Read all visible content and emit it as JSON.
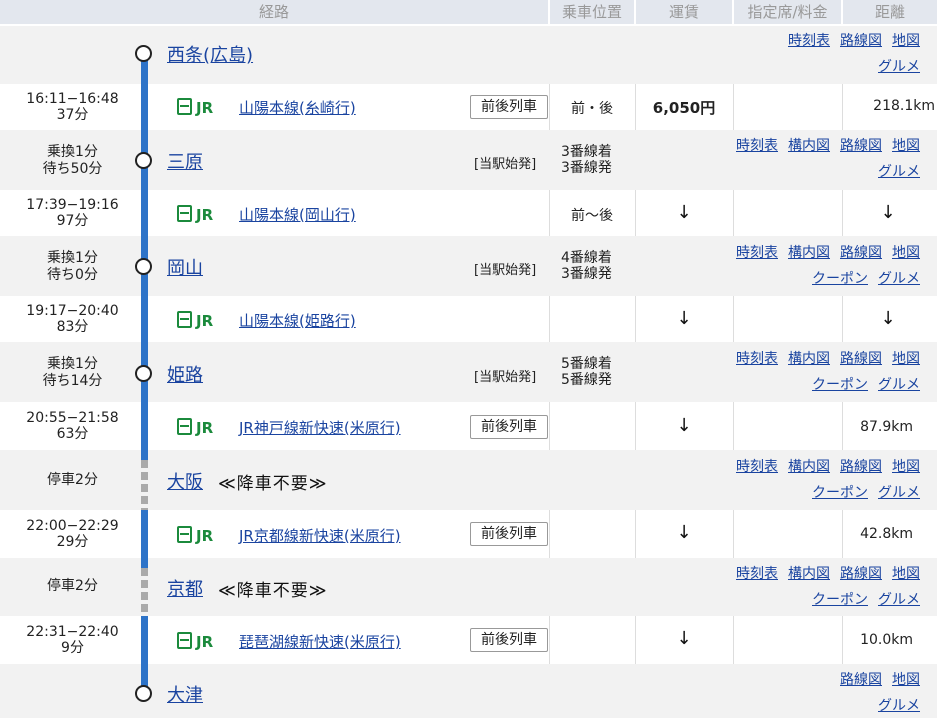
{
  "header": {
    "route": "経路",
    "position": "乗車位置",
    "fare": "運賃",
    "reserved": "指定席/料金",
    "distance": "距離"
  },
  "stations": {
    "saijo": {
      "name": "西条(広島)",
      "links": [
        "時刻表",
        "路線図",
        "地図",
        "グルメ"
      ]
    },
    "mihara": {
      "name": "三原",
      "transfer": "乗換1分",
      "wait": "待ち50分",
      "start": "[当駅始発]",
      "arrive": "3番線着",
      "depart": "3番線発",
      "links": [
        "時刻表",
        "構内図",
        "路線図",
        "地図",
        "グルメ"
      ]
    },
    "okayama": {
      "name": "岡山",
      "transfer": "乗換1分",
      "wait": "待ち0分",
      "start": "[当駅始発]",
      "arrive": "4番線着",
      "depart": "3番線発",
      "links": [
        "時刻表",
        "構内図",
        "路線図",
        "地図",
        "クーポン",
        "グルメ"
      ]
    },
    "himeji": {
      "name": "姫路",
      "transfer": "乗換1分",
      "wait": "待ち14分",
      "start": "[当駅始発]",
      "arrive": "5番線着",
      "depart": "5番線発",
      "links": [
        "時刻表",
        "構内図",
        "路線図",
        "地図",
        "クーポン",
        "グルメ"
      ]
    },
    "osaka": {
      "name": "大阪",
      "stop": "停車2分",
      "note": "≪降車不要≫",
      "links": [
        "時刻表",
        "構内図",
        "路線図",
        "地図",
        "クーポン",
        "グルメ"
      ]
    },
    "kyoto": {
      "name": "京都",
      "stop": "停車2分",
      "note": "≪降車不要≫",
      "links": [
        "時刻表",
        "構内図",
        "路線図",
        "地図",
        "クーポン",
        "グルメ"
      ]
    },
    "otsu": {
      "name": "大津",
      "links": [
        "路線図",
        "地図",
        "グルメ"
      ]
    }
  },
  "trains": {
    "t1": {
      "time": "16:11−16:48",
      "dur": "37分",
      "jr": "JR",
      "line": "山陽本線(糸崎行)",
      "btn": "前後列車",
      "pos": "前・後",
      "fare": "6,050円",
      "dist": "218.1km"
    },
    "t2": {
      "time": "17:39−19:16",
      "dur": "97分",
      "jr": "JR",
      "line": "山陽本線(岡山行)",
      "pos": "前〜後",
      "fare": "↓",
      "dist": "↓"
    },
    "t3": {
      "time": "19:17−20:40",
      "dur": "83分",
      "jr": "JR",
      "line": "山陽本線(姫路行)",
      "fare": "↓",
      "dist": "↓"
    },
    "t4": {
      "time": "20:55−21:58",
      "dur": "63分",
      "jr": "JR",
      "line": "JR神戸線新快速(米原行)",
      "btn": "前後列車",
      "fare": "↓",
      "dist": "87.9km"
    },
    "t5": {
      "time": "22:00−22:29",
      "dur": "29分",
      "jr": "JR",
      "line": "JR京都線新快速(米原行)",
      "btn": "前後列車",
      "fare": "↓",
      "dist": "42.8km"
    },
    "t6": {
      "time": "22:31−22:40",
      "dur": "9分",
      "jr": "JR",
      "line": "琵琶湖線新快速(米原行)",
      "btn": "前後列車",
      "fare": "↓",
      "dist": "10.0km"
    }
  }
}
